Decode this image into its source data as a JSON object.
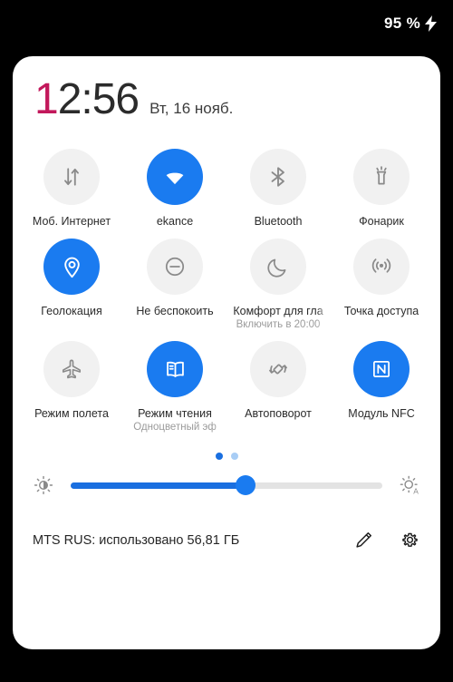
{
  "statusbar": {
    "battery_percent": "95 %",
    "charging_icon": "lightning-bolt-icon"
  },
  "panel": {
    "clock": {
      "time_first_digit": "1",
      "time_rest": "2:56",
      "time_full": "12:56",
      "date": "Вт, 16 нояб."
    },
    "accent_color": "#1a7bf0",
    "clock_accent_color": "#c2185b",
    "tiles": [
      {
        "label": "Моб. Интернет",
        "sub": "",
        "icon": "mobile-data-icon",
        "active": false
      },
      {
        "label": "ekance",
        "sub": "",
        "icon": "wifi-icon",
        "active": true
      },
      {
        "label": "Bluetooth",
        "sub": "",
        "icon": "bluetooth-icon",
        "active": false
      },
      {
        "label": "Фонарик",
        "sub": "",
        "icon": "flashlight-icon",
        "active": false
      },
      {
        "label": "Геолокация",
        "sub": "",
        "icon": "location-pin-icon",
        "active": true
      },
      {
        "label": "Не беспокоить",
        "sub": "",
        "icon": "do-not-disturb-icon",
        "active": false
      },
      {
        "label": "Комфорт для гла",
        "sub": "Включить в 20:00",
        "icon": "moon-icon",
        "active": false
      },
      {
        "label": "Точка доступа",
        "sub": "",
        "icon": "hotspot-icon",
        "active": false
      },
      {
        "label": "Режим полета",
        "sub": "",
        "icon": "airplane-icon",
        "active": false
      },
      {
        "label": "Режим чтения",
        "sub": "Одноцветный эф",
        "icon": "book-icon",
        "active": true
      },
      {
        "label": "Автоповорот",
        "sub": "",
        "icon": "auto-rotate-icon",
        "active": false
      },
      {
        "label": "Модуль NFC",
        "sub": "",
        "icon": "nfc-icon",
        "active": true
      }
    ],
    "pager": {
      "pages": 2,
      "current": 1
    },
    "brightness": {
      "left_icon": "brightness-low-icon",
      "right_icon": "brightness-auto-icon",
      "value_percent": 56
    },
    "footer": {
      "data_usage_text": "MTS RUS: использовано 56,81 ГБ",
      "edit_icon": "pencil-icon",
      "settings_icon": "gear-icon"
    }
  }
}
